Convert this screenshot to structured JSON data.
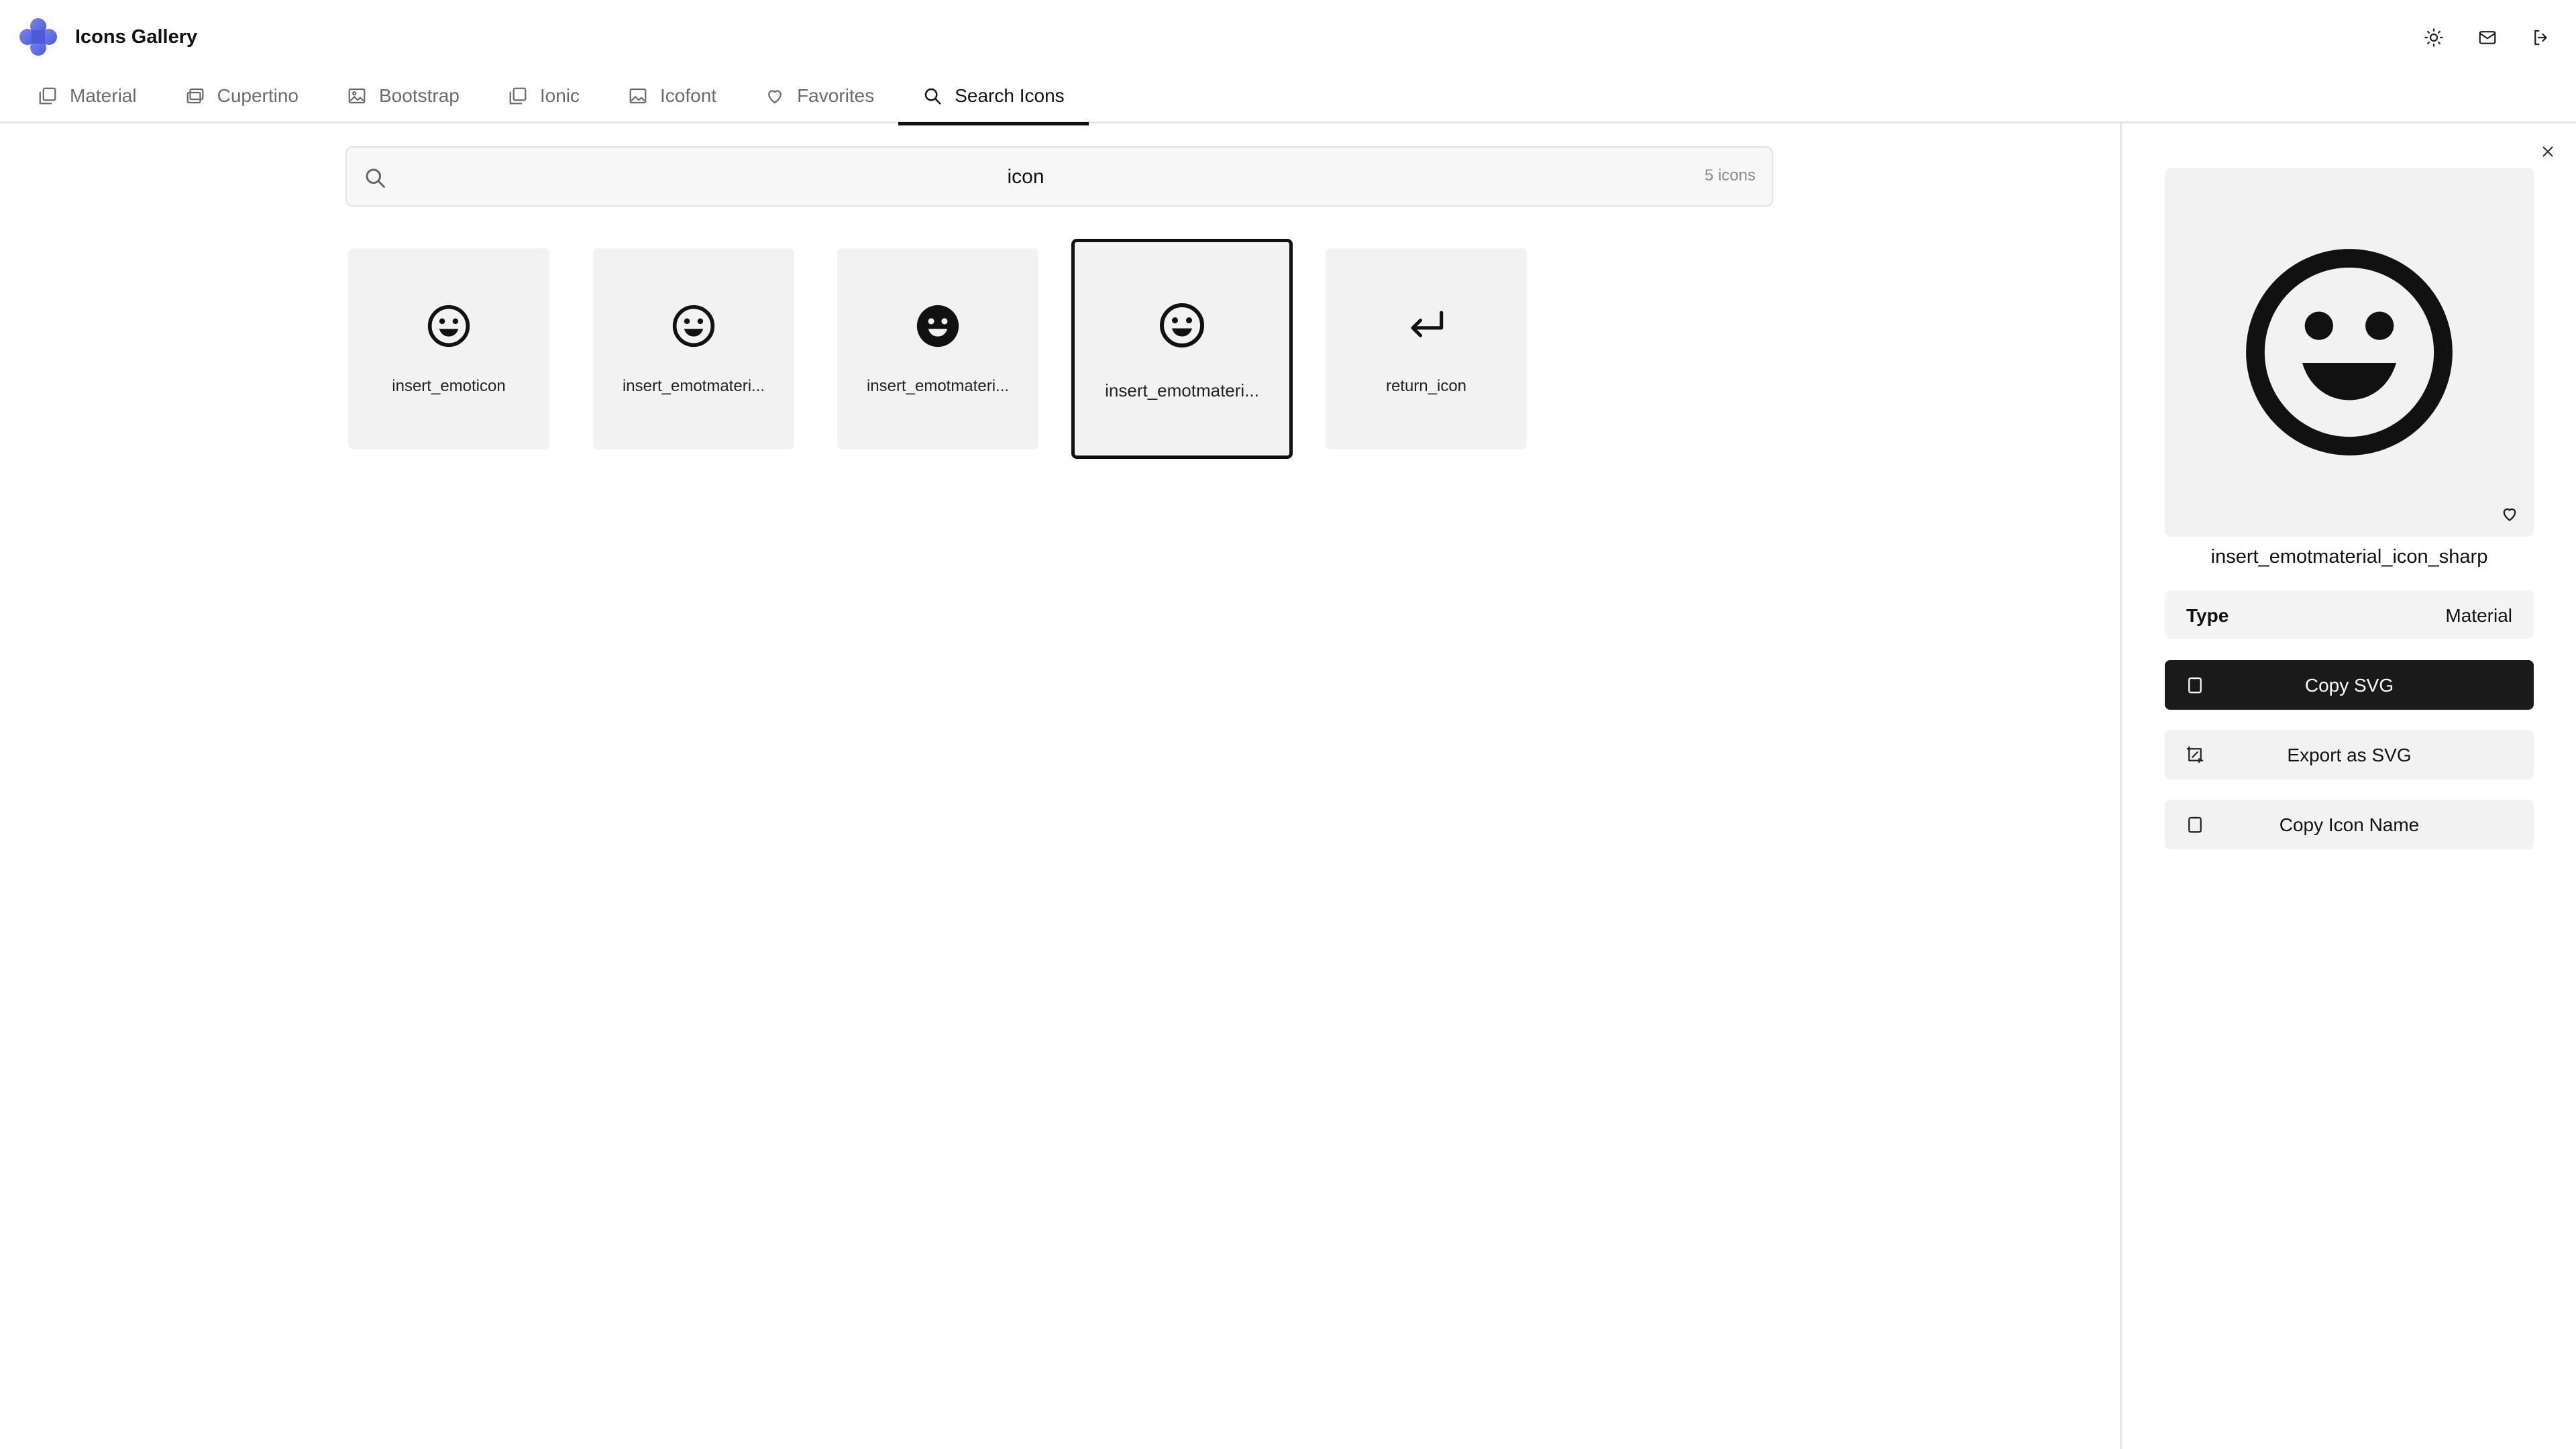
{
  "app": {
    "title": "Icons Gallery"
  },
  "header": {
    "actions": [
      {
        "icon": "sun-icon"
      },
      {
        "icon": "mail-icon"
      },
      {
        "icon": "logout-icon"
      }
    ]
  },
  "tabs": [
    {
      "label": "Material",
      "icon": "image-stack-icon"
    },
    {
      "label": "Cupertino",
      "icon": "photos-icon"
    },
    {
      "label": "Bootstrap",
      "icon": "image-icon"
    },
    {
      "label": "Ionic",
      "icon": "image-stack-icon"
    },
    {
      "label": "Icofont",
      "icon": "image-icon"
    },
    {
      "label": "Favorites",
      "icon": "heart-icon"
    },
    {
      "label": "Search Icons",
      "icon": "search-icon",
      "active": true
    }
  ],
  "search": {
    "value": "icon",
    "count": "5 icons"
  },
  "results": [
    {
      "label": "insert_emoticon",
      "icon": "smiley-outline-icon"
    },
    {
      "label": "insert_emotmateri...",
      "icon": "smiley-outline-icon"
    },
    {
      "label": "insert_emotmateri...",
      "icon": "smiley-filled-icon"
    },
    {
      "label": "insert_emotmateri...",
      "icon": "smiley-outline-icon",
      "selected": true
    },
    {
      "label": "return_icon",
      "icon": "return-arrow-icon"
    }
  ],
  "detail": {
    "name": "insert_emotmaterial_icon_sharp",
    "type_label": "Type",
    "type_value": "Material",
    "actions": {
      "copy_svg": "Copy SVG",
      "export_svg": "Export as SVG",
      "copy_name": "Copy Icon Name"
    }
  },
  "colors": {
    "accent": "#1a1a1a",
    "card_bg": "#f2f2f2",
    "logo": "#5b6ee8"
  }
}
